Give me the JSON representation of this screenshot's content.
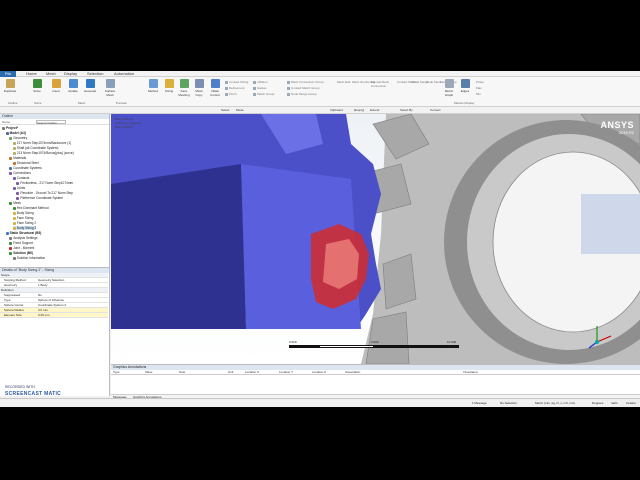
{
  "tabs": [
    "File",
    "Home",
    "Mesh",
    "Display",
    "Selection",
    "Automation"
  ],
  "ribbon": {
    "buttons": [
      {
        "label": "Duplicate",
        "color": "#c8a35a"
      },
      {
        "label": "Solve",
        "color": "#3c8d3c"
      },
      {
        "label": "Insert",
        "color": "#d9a23c"
      },
      {
        "label": "Update",
        "color": "#4a8bd1"
      },
      {
        "label": "Generate",
        "color": "#2f78c4"
      },
      {
        "label": "Surface Mesh",
        "color": "#8aa0b8"
      },
      {
        "label": "Method",
        "color": "#6a9bd4"
      },
      {
        "label": "Sizing",
        "color": "#d8b03a"
      },
      {
        "label": "Face Meshing",
        "color": "#5fa35f"
      },
      {
        "label": "Mesh Copy",
        "color": "#7a8fb3"
      },
      {
        "label": "Inflate Control",
        "color": "#4f7fc9"
      },
      {
        "label": "Metric Graph",
        "color": "#9aa8b8"
      },
      {
        "label": "Edges",
        "color": "#5b7ea8"
      }
    ],
    "groups": [
      "Outline",
      "Solve",
      "Mesh",
      "Preview",
      "Metrics Display"
    ],
    "small_items": [
      "Contact Sizing",
      "Refinement",
      "Pinch",
      "Inflation",
      "Gasket",
      "Match Group",
      "Mesh Connection Group",
      "Contact Match Group",
      "Node Merge Group",
      "Mesh Edit",
      "Mesh Numbering",
      "Manual Mesh Connection",
      "Contact Match",
      "Node Merge",
      "Node Move",
      "Mesh Group",
      "Probe",
      "Max",
      "Min"
    ]
  },
  "view_toolbar": [
    "Select",
    "Mode",
    "Clipboard",
    "[Empty]",
    "Extend",
    "Select By",
    "Convert"
  ],
  "outline": {
    "header": "Outline",
    "filter_label": "Name",
    "search_placeholder": "Search Outline",
    "nodes": [
      {
        "label": "Project*",
        "icon": "#7a7a7a",
        "bold": true
      },
      {
        "label": "Model (A4)",
        "icon": "#4a6fa5",
        "bold": true
      },
      {
        "label": "Geometry",
        "icon": "#6aa35f",
        "bold": false
      },
      {
        "label": "217 Norm Step1074mm/Backcurve (1)",
        "icon": "#b0b060",
        "bold": false
      },
      {
        "label": "Shaft (all Coordinate System)",
        "icon": "#b0b060",
        "bold": false
      },
      {
        "label": "213 Norm Step1074/Bonus[plus] (curve)",
        "icon": "#b0b060",
        "bold": false
      },
      {
        "label": "Materials",
        "icon": "#c07030",
        "bold": false
      },
      {
        "label": "Structural Steel",
        "icon": "#c07030",
        "bold": false
      },
      {
        "label": "Coordinate Systems",
        "icon": "#4a6fa5",
        "bold": false
      },
      {
        "label": "Connections",
        "icon": "#7a5aa5",
        "bold": false
      },
      {
        "label": "Contacts",
        "icon": "#7a5aa5",
        "bold": false
      },
      {
        "label": "Frictionless - 217 Norm Step1074mm",
        "icon": "#7a5aa5",
        "bold": false
      },
      {
        "label": "Joints",
        "icon": "#7a5aa5",
        "bold": false
      },
      {
        "label": "Revolute - Ground To 217 Norm Step",
        "icon": "#7a5aa5",
        "bold": false
      },
      {
        "label": "Reference Coordinate System",
        "icon": "#7a5aa5",
        "bold": false
      },
      {
        "label": "Mesh",
        "icon": "#3a8d3a",
        "bold": false
      },
      {
        "label": "Hex Dominant Method",
        "icon": "#3a8d3a",
        "bold": false
      },
      {
        "label": "Body Sizing",
        "icon": "#d8b03a",
        "bold": false
      },
      {
        "label": "Face Sizing",
        "icon": "#d8b03a",
        "bold": false
      },
      {
        "label": "Face Sizing 2",
        "icon": "#d8b03a",
        "bold": false
      },
      {
        "label": "Body Sizing 2",
        "icon": "#d8b03a",
        "bold": false
      },
      {
        "label": "Static Structural (B5)",
        "icon": "#3a7ac4",
        "bold": true
      },
      {
        "label": "Analysis Settings",
        "icon": "#7a7a7a",
        "bold": false
      },
      {
        "label": "Fixed Support",
        "icon": "#3a8d3a",
        "bold": false
      },
      {
        "label": "Joint - Moment",
        "icon": "#c03030",
        "bold": false
      },
      {
        "label": "Solution (B6)",
        "icon": "#3a8d3a",
        "bold": true
      },
      {
        "label": "Solution Information",
        "icon": "#7a7a7a",
        "bold": false
      }
    ],
    "selected_index": 20
  },
  "details": {
    "header": "Details of \"Body Sizing 2\" - Sizing",
    "rows": [
      {
        "k": "Scope",
        "v": "",
        "cat": true
      },
      {
        "k": "Scoping Method",
        "v": "Geometry Selection",
        "cat": false
      },
      {
        "k": "Geometry",
        "v": "1 Body",
        "cat": false
      },
      {
        "k": "Definition",
        "v": "",
        "cat": true
      },
      {
        "k": "Suppressed",
        "v": "No",
        "cat": false
      },
      {
        "k": "Type",
        "v": "Sphere of Influence",
        "cat": false
      },
      {
        "k": "Sphere Center",
        "v": "Coordinate System 2",
        "cat": false
      },
      {
        "k": "Sphere Radius",
        "v": "3.0 mm",
        "cat": false
      },
      {
        "k": "Element Size",
        "v": "0.25 mm",
        "cat": false
      }
    ]
  },
  "viewport": {
    "info": [
      "Body Sizing 2",
      "Sphere of Influence",
      "Body Sizing 2"
    ],
    "brand": "ANSYS",
    "version": "2019 R2",
    "scale_labels": [
      "0.000",
      "5.000",
      "10.000 (mm)"
    ]
  },
  "annotations": {
    "header": "Graphics Annotations",
    "columns": [
      "Type",
      "Value",
      "Note",
      "Unit",
      "Location X",
      "Location Y",
      "Location Z",
      "Association",
      "Timestamp"
    ]
  },
  "messages_tabs": [
    "Messages",
    "Graphics Annotations"
  ],
  "status": {
    "messages": "1 Message",
    "selection": "No Selection",
    "units": "Metric (mm, kg, N, s, mV, mA)",
    "degrees": "Degrees",
    "rads": "rad/s",
    "temp": "Celsius"
  },
  "watermark": {
    "recorded": "RECORDED WITH",
    "brand": "SCREENCAST MATIC"
  },
  "colors": {
    "gear_blue": "#4b4fc8",
    "gear_dark": "#2e318f",
    "highlight": "#d42a2a",
    "ribbon_file": "#2b6cb0"
  }
}
